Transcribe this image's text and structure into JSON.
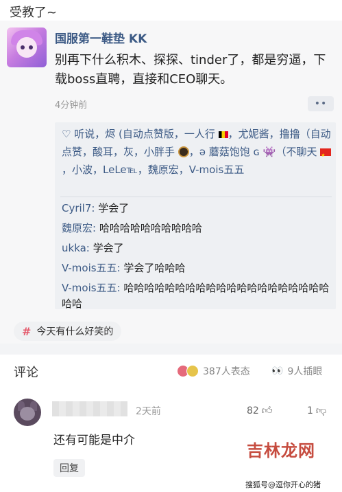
{
  "caption": "受教了~",
  "post": {
    "author": "国服第一鞋垫 KK",
    "body": "别再下什么积木、探探、tinder了，都是穷逼，下载boss直聘，直接和CEO聊天。",
    "time": "4分钟前",
    "more_label": "••",
    "likes_line_1": "听说，烬 (自动点赞版，一人行",
    "likes_line_2": "，尤妮酱，撸撸（自动点赞，酸耳，灰，小胖手",
    "likes_line_3": "，ə 蘑菇饱饱 ɢ",
    "likes_line_4": "（不聊天",
    "likes_line_5": "，小波，LeLe℡，魏原宏，V-mois五五",
    "comments": [
      {
        "name": "Cyril7:",
        "text": " 学会了"
      },
      {
        "name": "魏原宏:",
        "text": " 哈哈哈哈哈哈哈哈哈哈"
      },
      {
        "name": "ukka:",
        "text": " 学会了"
      },
      {
        "name": "V-mois五五:",
        "text": " 学会了哈哈哈"
      },
      {
        "name": "V-mois五五:",
        "text": " 哈哈哈哈哈哈哈哈哈哈哈哈哈哈哈哈哈哈哈哈哈哈"
      }
    ],
    "topic": "今天有什么好笑的"
  },
  "comments_section": {
    "title": "评论",
    "reaction_count": "387人表态",
    "peek_count": "9人插眼"
  },
  "reply": {
    "time": "2天前",
    "likes": "82",
    "dislikes": "1",
    "text": "还有可能是中介",
    "reply_label": "回复"
  },
  "watermark": {
    "big": "吉林龙网",
    "small": "搜狐号@逗你开心的猪"
  },
  "colors": {
    "link_blue": "#3c5a85",
    "topic_hash": "#e4596b",
    "watermark": "#c0392b"
  }
}
